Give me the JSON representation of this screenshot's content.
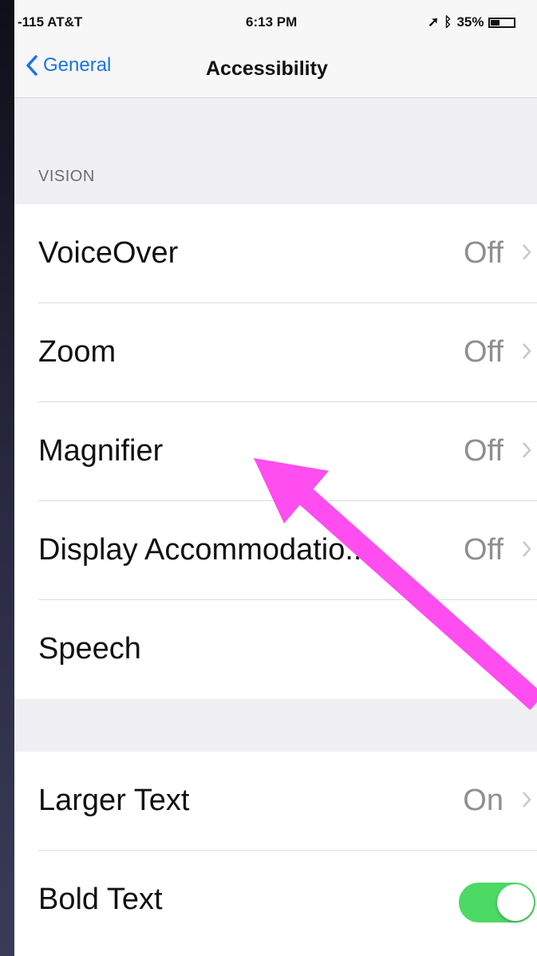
{
  "status_bar": {
    "signal": "-115 AT&T",
    "time": "6:13 PM",
    "battery": "35%"
  },
  "nav": {
    "back_label": "General",
    "title": "Accessibility"
  },
  "sections": {
    "vision_header": "VISION"
  },
  "vision_rows": [
    {
      "label": "VoiceOver",
      "value": "Off"
    },
    {
      "label": "Zoom",
      "value": "Off"
    },
    {
      "label": "Magnifier",
      "value": "Off"
    },
    {
      "label": "Display Accommodatio...",
      "value": "Off"
    },
    {
      "label": "Speech",
      "value": ""
    }
  ],
  "text_rows": [
    {
      "label": "Larger Text",
      "value": "On"
    },
    {
      "label": "Bold Text",
      "toggle_on": true
    }
  ],
  "colors": {
    "accent": "#1a73e8",
    "toggle_on": "#4cd964",
    "annotation_arrow": "#ff4df0"
  },
  "icons": {
    "back": "chevron-back-icon",
    "disclosure": "chevron-right-icon",
    "wifi": "wifi-icon",
    "bluetooth": "bluetooth-icon",
    "battery": "battery-icon"
  }
}
